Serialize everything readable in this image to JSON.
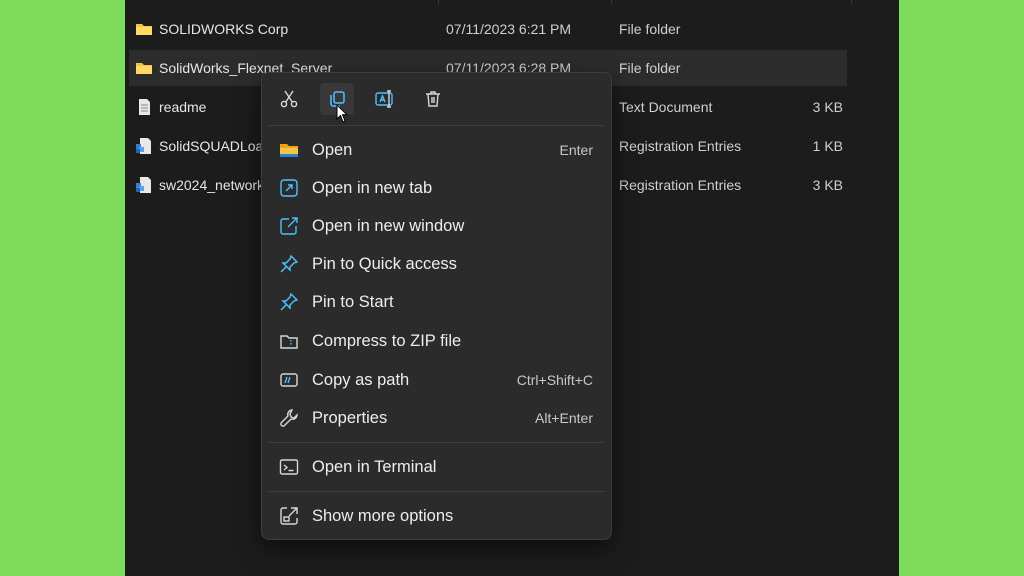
{
  "files": [
    {
      "name": "SOLIDWORKS Corp",
      "date": "07/11/2023 6:21 PM",
      "type": "File folder",
      "size": "",
      "icon": "folder-icon"
    },
    {
      "name": "SolidWorks_Flexnet_Server",
      "date": "07/11/2023 6:28 PM",
      "type": "File folder",
      "size": "",
      "icon": "folder-icon"
    },
    {
      "name": "readme",
      "date": "",
      "type": "Text Document",
      "size": "3 KB",
      "icon": "text-document-icon"
    },
    {
      "name": "SolidSQUADLoa",
      "date": "",
      "type": "Registration Entries",
      "size": "1 KB",
      "icon": "registry-file-icon"
    },
    {
      "name": "sw2024_network",
      "date": "",
      "type": "Registration Entries",
      "size": "3 KB",
      "icon": "registry-file-icon"
    }
  ],
  "context_menu": {
    "toolbar": [
      {
        "icon": "cut-icon"
      },
      {
        "icon": "copy-icon"
      },
      {
        "icon": "rename-icon"
      },
      {
        "icon": "delete-icon"
      }
    ],
    "items": [
      {
        "label": "Open",
        "shortcut": "Enter",
        "icon": "folder-open-icon"
      },
      {
        "label": "Open in new tab",
        "shortcut": "",
        "icon": "new-tab-icon"
      },
      {
        "label": "Open in new window",
        "shortcut": "",
        "icon": "new-window-icon"
      },
      {
        "label": "Pin to Quick access",
        "shortcut": "",
        "icon": "pin-icon"
      },
      {
        "label": "Pin to Start",
        "shortcut": "",
        "icon": "pin-icon"
      },
      {
        "label": "Compress to ZIP file",
        "shortcut": "",
        "icon": "zip-icon"
      },
      {
        "label": "Copy as path",
        "shortcut": "Ctrl+Shift+C",
        "icon": "copy-path-icon"
      },
      {
        "label": "Properties",
        "shortcut": "Alt+Enter",
        "icon": "wrench-icon"
      },
      {
        "label": "Open in Terminal",
        "shortcut": "",
        "icon": "terminal-icon"
      },
      {
        "label": "Show more options",
        "shortcut": "",
        "icon": "more-options-icon"
      }
    ]
  },
  "colors": {
    "background": "#7edb5c",
    "explorer": "#1c1c1c",
    "menu": "#2b2b2b",
    "accent": "#4cc2ff",
    "folder": "#f6c444"
  }
}
